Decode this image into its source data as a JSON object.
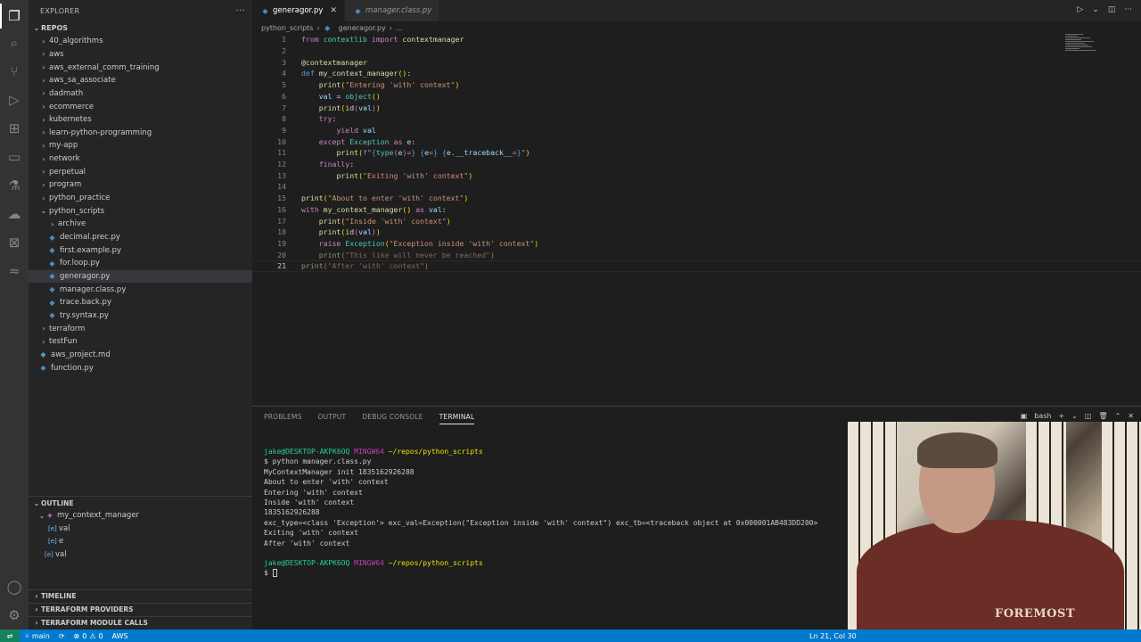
{
  "explorer": {
    "title": "EXPLORER",
    "more": "···",
    "root": "REPOS",
    "items": [
      {
        "label": "40_algorithms",
        "kind": "folder",
        "depth": 1
      },
      {
        "label": "aws",
        "kind": "folder",
        "depth": 1
      },
      {
        "label": "aws_external_comm_training",
        "kind": "folder",
        "depth": 1
      },
      {
        "label": "aws_sa_associate",
        "kind": "folder",
        "depth": 1
      },
      {
        "label": "dadmath",
        "kind": "folder",
        "depth": 1
      },
      {
        "label": "ecommerce",
        "kind": "folder",
        "depth": 1
      },
      {
        "label": "kubernetes",
        "kind": "folder",
        "depth": 1
      },
      {
        "label": "learn-python-programming",
        "kind": "folder",
        "depth": 1
      },
      {
        "label": "my-app",
        "kind": "folder",
        "depth": 1
      },
      {
        "label": "network",
        "kind": "folder",
        "depth": 1
      },
      {
        "label": "perpetual",
        "kind": "folder",
        "depth": 1
      },
      {
        "label": "program",
        "kind": "folder",
        "depth": 1
      },
      {
        "label": "python_practice",
        "kind": "folder",
        "depth": 1
      },
      {
        "label": "python_scripts",
        "kind": "folder-open",
        "depth": 1
      },
      {
        "label": "archive",
        "kind": "folder",
        "depth": 2
      },
      {
        "label": "decimal.prec.py",
        "kind": "py",
        "depth": 2
      },
      {
        "label": "first.example.py",
        "kind": "py",
        "depth": 2
      },
      {
        "label": "for.loop.py",
        "kind": "py",
        "depth": 2
      },
      {
        "label": "generagor.py",
        "kind": "py",
        "depth": 2,
        "selected": true
      },
      {
        "label": "manager.class.py",
        "kind": "py",
        "depth": 2
      },
      {
        "label": "trace.back.py",
        "kind": "py",
        "depth": 2
      },
      {
        "label": "try.syntax.py",
        "kind": "py",
        "depth": 2
      },
      {
        "label": "terraform",
        "kind": "folder",
        "depth": 1
      },
      {
        "label": "testFun",
        "kind": "folder",
        "depth": 1
      },
      {
        "label": "aws_project.md",
        "kind": "md",
        "depth": 1
      },
      {
        "label": "function.py",
        "kind": "py",
        "depth": 1
      }
    ]
  },
  "outline": {
    "title": "OUTLINE",
    "items": [
      {
        "label": "my_context_manager",
        "depth": 1,
        "icon": "cube-icon"
      },
      {
        "label": "val",
        "depth": 2,
        "icon": "variable-icon"
      },
      {
        "label": "e",
        "depth": 2,
        "icon": "variable-icon"
      },
      {
        "label": "val",
        "depth": 1,
        "icon": "variable-icon"
      }
    ]
  },
  "bottom_sections": [
    "TIMELINE",
    "TERRAFORM PROVIDERS",
    "TERRAFORM MODULE CALLS"
  ],
  "tabs": [
    {
      "label": "generagor.py",
      "active": true
    },
    {
      "label": "manager.class.py",
      "active": false
    }
  ],
  "breadcrumb": [
    "python_scripts",
    "generagor.py",
    "..."
  ],
  "code_lines": [
    "1",
    "2",
    "3",
    "4",
    "5",
    "6",
    "7",
    "8",
    "9",
    "10",
    "11",
    "12",
    "13",
    "14",
    "15",
    "16",
    "17",
    "18",
    "19",
    "20",
    "21"
  ],
  "panel": {
    "tabs": [
      "PROBLEMS",
      "OUTPUT",
      "DEBUG CONSOLE",
      "TERMINAL"
    ],
    "active_tab": "TERMINAL",
    "shell": "bash",
    "terminal": {
      "prompt_user": "jake@DESKTOP-AKPK6OQ",
      "prompt_env": "MINGW64",
      "prompt_path": "~/repos/python_scripts",
      "command": "$ python manager.class.py",
      "output": [
        "MyContextManager init 1835162926288",
        "About to enter 'with' context",
        "Entering 'with' context",
        "Inside 'with' context",
        "1835162926288",
        "exc_type=<class 'Exception'> exc_val=Exception(\"Exception inside 'with' context\") exc_tb=<traceback object at 0x000001AB483DD200>",
        "Exiting 'with' context",
        "After 'with' context"
      ],
      "final_prompt": "$ "
    }
  },
  "statusbar": {
    "branch": "main",
    "errors": "0",
    "warnings": "0",
    "profile": "AWS",
    "position": "Ln 21, Col 30"
  },
  "webcam": {
    "shirt_text": "FOREMOST"
  }
}
